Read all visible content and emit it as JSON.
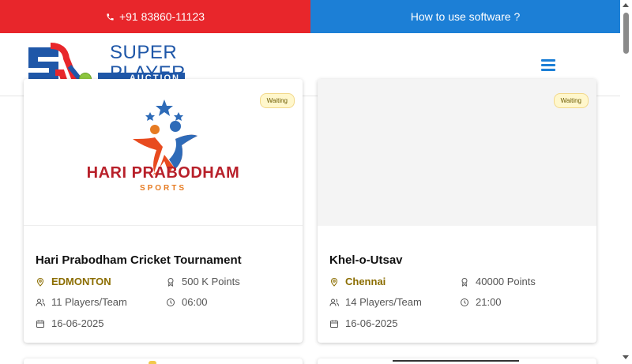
{
  "topbar": {
    "phone": "+91 83860-11123",
    "howto": "How to use software ?"
  },
  "logo": {
    "word1": "SUPER",
    "word2": "PLAYER",
    "word3": "AUCTION"
  },
  "colors": {
    "phone_bar": "#e8262b",
    "howto_bar": "#1c7fd6",
    "brand_blue": "#1f57a8",
    "badge_bg": "#fff7cc",
    "location_text": "#8b6d00"
  },
  "tournaments": [
    {
      "status": "Waiting",
      "title": "Hari Prabodham Cricket Tournament",
      "location": "EDMONTON",
      "points": "500 K Points",
      "players": "11 Players/Team",
      "time": "06:00",
      "date": "16-06-2025",
      "sponsor_name": "HARI PRABODHAM",
      "sponsor_sub": "SPORTS"
    },
    {
      "status": "Waiting",
      "title": "Khel-o-Utsav",
      "location": "Chennai",
      "points": "40000 Points",
      "players": "14 Players/Team",
      "time": "21:00",
      "date": "16-06-2025"
    }
  ]
}
